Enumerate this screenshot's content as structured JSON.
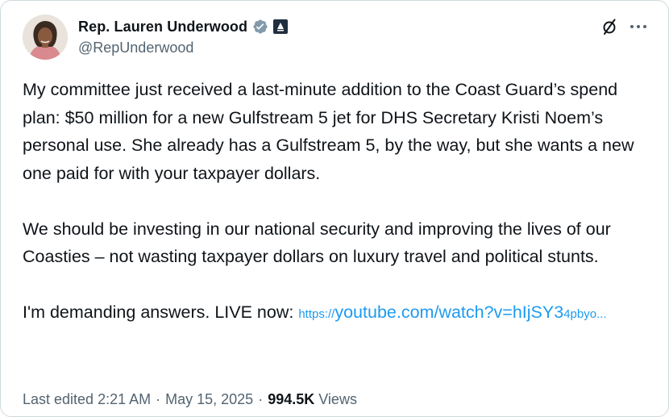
{
  "author": {
    "display_name": "Rep. Lauren Underwood",
    "handle": "@RepUnderwood",
    "avatar_icon": "profile-photo",
    "verified_icon": "verified-gray-badge-icon",
    "affiliate_icon": "government-affiliate-badge-icon"
  },
  "actions": {
    "grok_icon": "grok-icon",
    "more_icon": "more-dots-icon"
  },
  "tweet": {
    "paragraph_1": "My committee just received a last-minute addition to the Coast Guard’s spend plan: $50 million for a new Gulfstream 5 jet for DHS Secretary Kristi Noem’s personal use. She already has a Gulfstream 5, by the way, but she wants a new one paid for with your taxpayer dollars.",
    "paragraph_2": "We should be investing in our national security and improving the lives of our Coasties – not wasting taxpayer dollars on luxury travel and political stunts.",
    "paragraph_3_text": "I'm demanding answers. LIVE now: ",
    "link_scheme": "https://",
    "link_main": "youtube.com/watch?v=hIjSY3",
    "link_tail": "4pbyo..."
  },
  "meta": {
    "edited_label": "Last edited 2:21 AM",
    "separator": "·",
    "date": "May 15, 2025",
    "views_count": "994.5K",
    "views_label": "Views"
  },
  "colors": {
    "link": "#1d9bf0",
    "secondary_text": "#536471",
    "primary_text": "#0f1419",
    "border": "#cfd9de"
  }
}
